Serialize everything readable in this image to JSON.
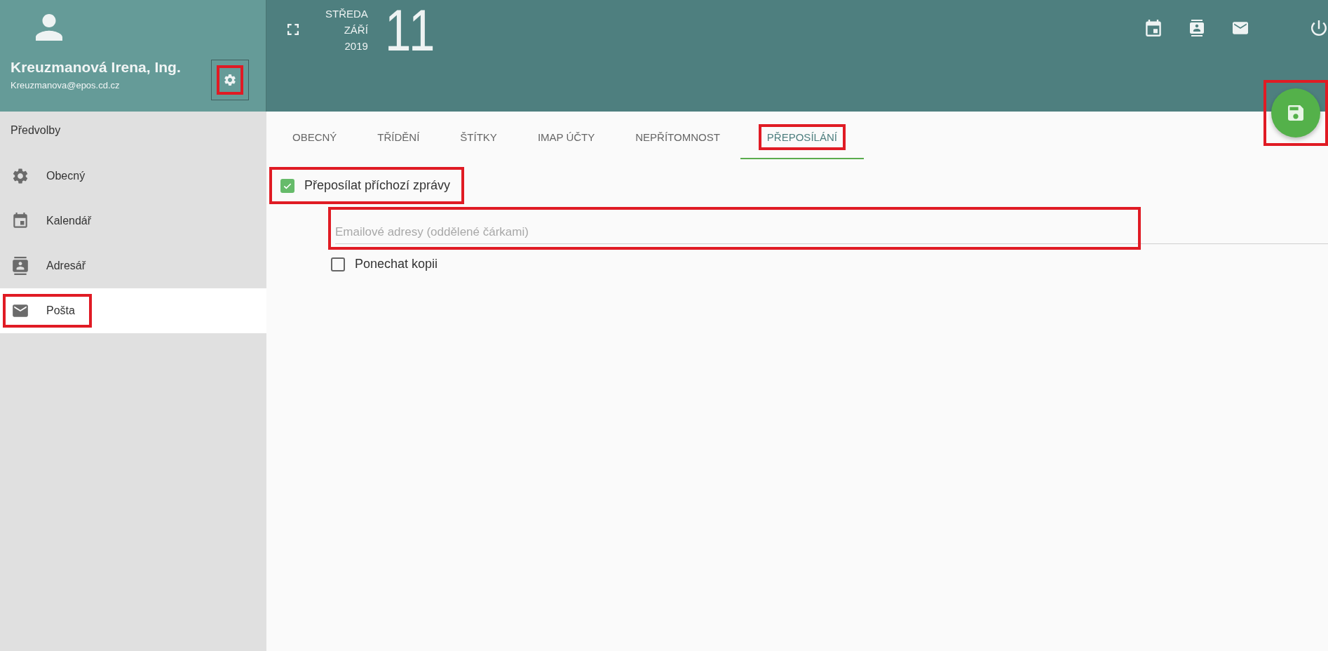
{
  "user": {
    "name": "Kreuzmanová Irena, Ing.",
    "email": "Kreuzmanova@epos.cd.cz"
  },
  "settings_button": {
    "highlighted": true
  },
  "date": {
    "weekday": "STŘEDA",
    "month": "ZÁŘÍ",
    "year": "2019",
    "day": "11"
  },
  "sidebar": {
    "title": "Předvolby",
    "items": [
      {
        "kind": "gear",
        "label": "Obecný",
        "selected": false,
        "highlighted": false
      },
      {
        "kind": "calendar",
        "label": "Kalendář",
        "selected": false,
        "highlighted": false
      },
      {
        "kind": "contacts",
        "label": "Adresář",
        "selected": false,
        "highlighted": false
      },
      {
        "kind": "mail",
        "label": "Pošta",
        "selected": true,
        "highlighted": true
      }
    ]
  },
  "tabs": [
    {
      "label": "OBECNÝ",
      "selected": false,
      "highlighted": false
    },
    {
      "label": "TŘÍDĚNÍ",
      "selected": false,
      "highlighted": false
    },
    {
      "label": "ŠTÍTKY",
      "selected": false,
      "highlighted": false
    },
    {
      "label": "IMAP ÚČTY",
      "selected": false,
      "highlighted": false
    },
    {
      "label": "NEPŘÍTOMNOST",
      "selected": false,
      "highlighted": false
    },
    {
      "label": "PŘEPOSÍLÁNÍ",
      "selected": true,
      "highlighted": true
    }
  ],
  "forward_checkbox": {
    "label": "Přeposílat příchozí zprávy",
    "checked": true,
    "highlighted": true
  },
  "email_field": {
    "placeholder": "Emailové adresy (oddělené čárkami)",
    "highlighted": true
  },
  "keep_copy_checkbox": {
    "label": "Ponechat kopii",
    "checked": false
  },
  "save_button": {
    "highlighted": true
  }
}
